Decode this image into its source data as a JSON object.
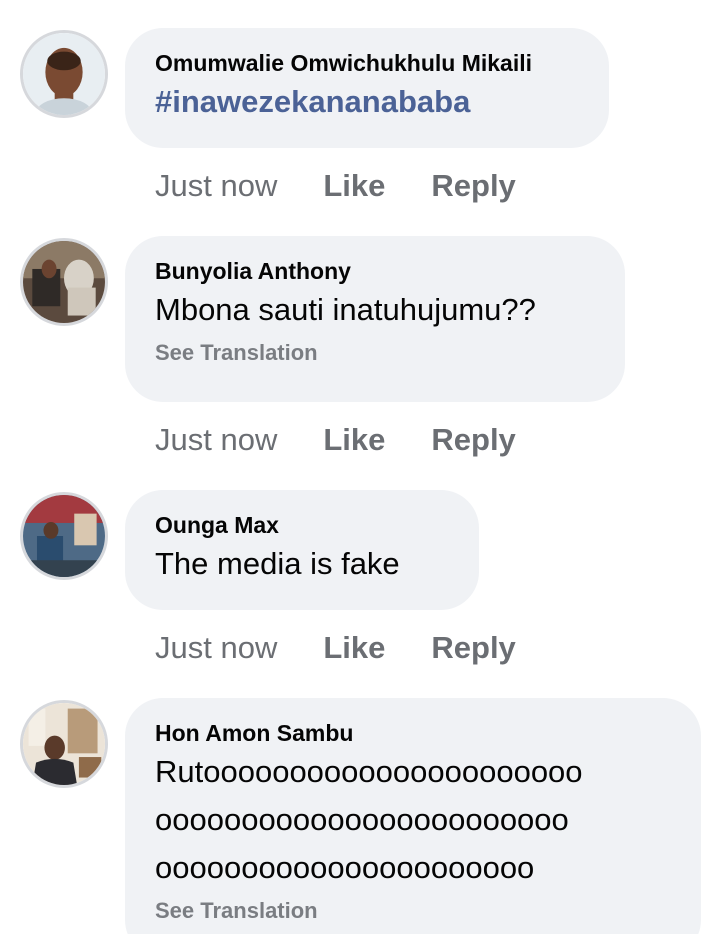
{
  "comments": [
    {
      "author": "Omumwalie Omwichukhulu Mikaili",
      "text": "#inawezekananababa",
      "is_hashtag": true,
      "see_translation": "",
      "time": "Just now",
      "like": "Like",
      "reply": "Reply"
    },
    {
      "author": "Bunyolia Anthony",
      "text": "Mbona sauti inatuhujumu??",
      "is_hashtag": false,
      "see_translation": "See Translation",
      "time": "Just now",
      "like": "Like",
      "reply": "Reply"
    },
    {
      "author": "Ounga Max",
      "text": "The media is fake",
      "is_hashtag": false,
      "see_translation": "",
      "time": "Just now",
      "like": "Like",
      "reply": "Reply"
    },
    {
      "author": "Hon Amon Sambu",
      "text_lines": [
        "Rutoooooooooooooooooooooo",
        "oooooooooooooooooooooooo",
        "oooooooooooooooooooooo"
      ],
      "see_translation": "See Translation"
    }
  ]
}
